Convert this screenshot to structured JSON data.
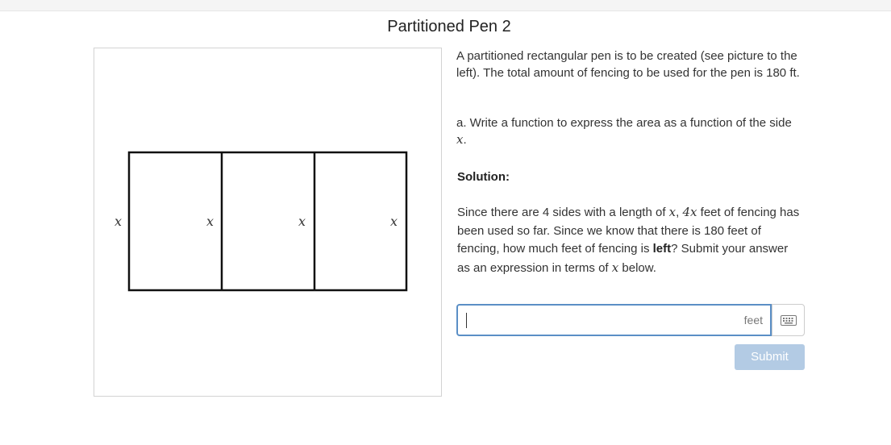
{
  "page": {
    "title": "Partitioned Pen 2"
  },
  "figure": {
    "side_labels": [
      "x",
      "x",
      "x",
      "x"
    ]
  },
  "problem": {
    "intro": "A partitioned rectangular pen is to be created (see picture to the left). The total amount of fencing to be used for the pen is 180 ft.",
    "question_prefix": "a. Write a function to express the area as a function of the side ",
    "question_var": "x",
    "question_suffix": ".",
    "solution_heading": "Solution:",
    "solution_parts": {
      "p1": "Since there are 4 sides with a length of ",
      "v1": "x",
      "p2": ", ",
      "v2": "4x",
      "p3": " feet of fencing has been used so far. Since we know that there is 180 feet of fencing, how much feet of fencing is ",
      "bold": "left",
      "p4": "? Submit your answer as an expression in terms of ",
      "v3": "x",
      "p5": " below."
    }
  },
  "answer": {
    "value": "",
    "unit": "feet",
    "keyboard_icon": "keyboard-icon"
  },
  "submit": {
    "label": "Submit"
  },
  "colors": {
    "input_border": "#5b8fc6",
    "submit_bg": "#b3cbe4"
  }
}
